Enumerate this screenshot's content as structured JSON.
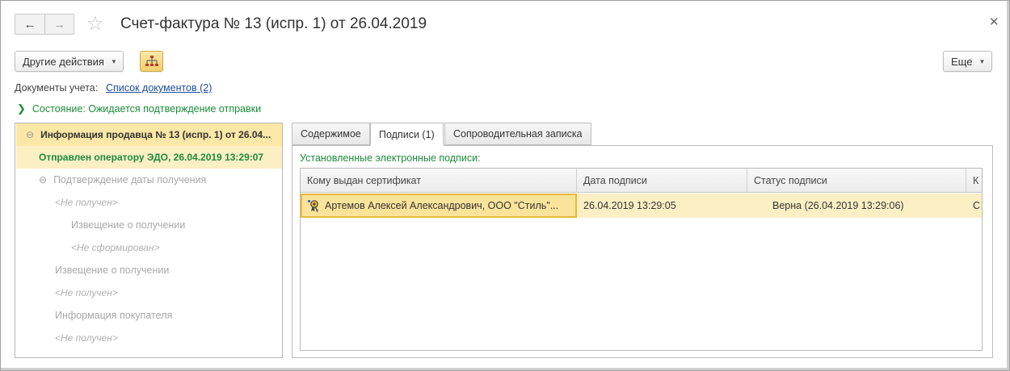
{
  "window": {
    "title": "Счет-фактура № 13 (испр. 1) от 26.04.2019"
  },
  "toolbar": {
    "other_actions_label": "Другие действия",
    "more_label": "Еще"
  },
  "documents": {
    "label": "Документы учета:",
    "link_text": "Список документов (2)"
  },
  "state": {
    "text": "Состояние: Ожидается подтверждение отправки"
  },
  "tree": {
    "items": [
      {
        "text": "Информация продавца № 13 (испр. 1) от 26.04...",
        "style": "bold",
        "toggle": "⊖"
      },
      {
        "text": "Отправлен оператору ЭДО, 26.04.2019 13:29:07",
        "style": "green"
      },
      {
        "text": "Подтверждение даты получения",
        "style": "gray",
        "toggle": "⊖"
      },
      {
        "text": "<Не получен>",
        "style": "italic"
      },
      {
        "text": "Извещение о получении",
        "style": "gray"
      },
      {
        "text": "<Не сформирован>",
        "style": "italic"
      },
      {
        "text": "Извещение о получении",
        "style": "gray"
      },
      {
        "text": "<Не получен>",
        "style": "italic"
      },
      {
        "text": "Информация покупателя",
        "style": "gray"
      },
      {
        "text": "<Не получен>",
        "style": "italic"
      }
    ]
  },
  "tabs": [
    {
      "label": "Содержимое"
    },
    {
      "label": "Подписи (1)",
      "active": true
    },
    {
      "label": "Сопроводительная записка"
    }
  ],
  "signatures": {
    "label": "Установленные электронные подписи:",
    "columns": [
      "Кому выдан сертификат",
      "Дата подписи",
      "Статус подписи",
      "К"
    ],
    "rows": [
      [
        "Артемов Алексей Александрович, ООО \"Стиль\"...",
        "26.04.2019 13:29:05",
        "Верна (26.04.2019 13:29:06)",
        "С"
      ]
    ]
  },
  "colors": {
    "accent_green": "#1a8c3a",
    "link_blue": "#1f4e99",
    "selection_yellow": "#fbe7a6"
  },
  "icons": [
    "back-arrow-icon",
    "forward-arrow-icon",
    "star-icon",
    "close-icon",
    "structure-icon",
    "chevron-right-icon",
    "certificate-icon"
  ]
}
